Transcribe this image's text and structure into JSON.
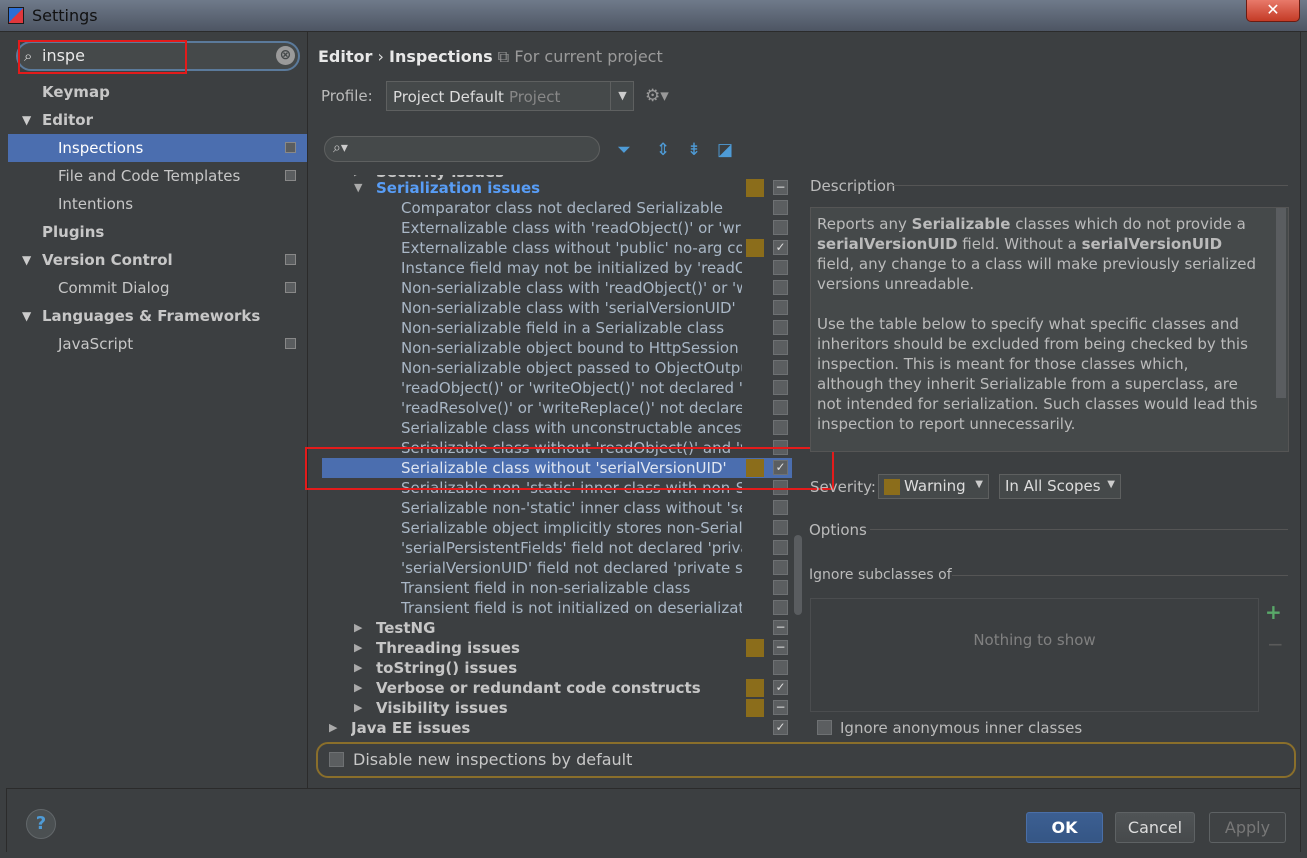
{
  "window": {
    "title": "Settings",
    "close_glyph": "✕"
  },
  "search": {
    "value": "inspe",
    "icon": "search-icon",
    "clear_glyph": "⊗"
  },
  "nav": {
    "items": [
      {
        "label": "Keymap",
        "level": 0,
        "bold": true
      },
      {
        "label": "Editor",
        "level": 0,
        "bold": true,
        "expanded": true
      },
      {
        "label": "Inspections",
        "level": 1,
        "selected": true
      },
      {
        "label": "File and Code Templates",
        "level": 1
      },
      {
        "label": "Intentions",
        "level": 1
      },
      {
        "label": "Plugins",
        "level": 0,
        "bold": true
      },
      {
        "label": "Version Control",
        "level": 0,
        "bold": true,
        "expanded": true
      },
      {
        "label": "Commit Dialog",
        "level": 1
      },
      {
        "label": "Languages & Frameworks",
        "level": 0,
        "bold": true,
        "expanded": true
      },
      {
        "label": "JavaScript",
        "level": 1
      }
    ]
  },
  "breadcrumb": {
    "part1": "Editor",
    "sep": "›",
    "part2": "Inspections",
    "scope": "For current project"
  },
  "profile": {
    "label": "Profile:",
    "value": "Project Default",
    "hint": "Project"
  },
  "tree": {
    "rows": [
      {
        "text": "Security issues",
        "type": "group-partial"
      },
      {
        "text": "Serialization issues",
        "type": "group-open",
        "sev": true,
        "cb": "−"
      },
      {
        "text": "Comparator class not declared Serializable",
        "type": "item",
        "cb": ""
      },
      {
        "text": "Externalizable class with 'readObject()' or 'writeObject()'",
        "type": "item",
        "cb": ""
      },
      {
        "text": "Externalizable class without 'public' no-arg constructor",
        "type": "item",
        "sev": true,
        "cb": "✓"
      },
      {
        "text": "Instance field may not be initialized by 'readObject()'",
        "type": "item",
        "cb": ""
      },
      {
        "text": "Non-serializable class with 'readObject()' or 'writeObject()'",
        "type": "item",
        "cb": ""
      },
      {
        "text": "Non-serializable class with 'serialVersionUID'",
        "type": "item",
        "cb": ""
      },
      {
        "text": "Non-serializable field in a Serializable class",
        "type": "item",
        "cb": ""
      },
      {
        "text": "Non-serializable object bound to HttpSession",
        "type": "item",
        "cb": ""
      },
      {
        "text": "Non-serializable object passed to ObjectOutputStream",
        "type": "item",
        "cb": ""
      },
      {
        "text": "'readObject()' or 'writeObject()' not declared 'private'",
        "type": "item",
        "cb": ""
      },
      {
        "text": "'readResolve()' or 'writeReplace()' not declared 'protected'",
        "type": "item",
        "cb": ""
      },
      {
        "text": "Serializable class with unconstructable ancestor",
        "type": "item",
        "cb": ""
      },
      {
        "text": "Serializable class without 'readObject()' and 'writeObject()'",
        "type": "item",
        "cb": ""
      },
      {
        "text": "Serializable class without 'serialVersionUID'",
        "type": "item",
        "sev": true,
        "cb": "✓",
        "selected": true
      },
      {
        "text": "Serializable non-'static' inner class with non-Serializable outer class",
        "type": "item",
        "cb": ""
      },
      {
        "text": "Serializable non-'static' inner class without 'serialVersionUID'",
        "type": "item",
        "cb": ""
      },
      {
        "text": "Serializable object implicitly stores non-Serializable object",
        "type": "item",
        "cb": ""
      },
      {
        "text": "'serialPersistentFields' field not declared 'private static final'",
        "type": "item",
        "cb": ""
      },
      {
        "text": "'serialVersionUID' field not declared 'private static final long'",
        "type": "item",
        "cb": ""
      },
      {
        "text": "Transient field in non-serializable class",
        "type": "item",
        "cb": ""
      },
      {
        "text": "Transient field is not initialized on deserialization",
        "type": "item",
        "cb": ""
      },
      {
        "text": "TestNG",
        "type": "group",
        "cb": "−"
      },
      {
        "text": "Threading issues",
        "type": "group",
        "sev": true,
        "cb": "−"
      },
      {
        "text": "toString() issues",
        "type": "group",
        "cb": ""
      },
      {
        "text": "Verbose or redundant code constructs",
        "type": "group",
        "sev": true,
        "cb": "✓"
      },
      {
        "text": "Visibility issues",
        "type": "group",
        "sev": true,
        "cb": "−"
      },
      {
        "text": "Java EE issues",
        "type": "group-top",
        "cb": "✓"
      }
    ]
  },
  "description": {
    "label": "Description",
    "p1_a": "Reports any ",
    "p1_b": "Serializable",
    "p1_c": " classes which do not provide a ",
    "p1_d": "serialVersionUID",
    "p1_e": " field. Without a ",
    "p1_f": "serialVersionUID",
    "p1_g": " field, any change to a class will make previously serialized versions unreadable.",
    "p2": "Use the table below to specify what specific classes and inheritors should be excluded from being checked by this inspection. This is meant for those classes which, although they inherit Serializable from a superclass, are not intended for serialization. Such classes would lead this inspection to report unnecessarily."
  },
  "severity": {
    "label": "Severity:",
    "value": "Warning",
    "scope": "In All Scopes"
  },
  "options": {
    "label": "Options",
    "ignore_label": "Ignore subclasses of",
    "empty_text": "Nothing to show",
    "anon_label": "Ignore anonymous inner classes"
  },
  "disable_new": {
    "label": "Disable new inspections by default"
  },
  "buttons": {
    "ok": "OK",
    "cancel": "Cancel",
    "apply": "Apply",
    "help": "?"
  },
  "colors": {
    "selection": "#4b6eaf",
    "warning": "#8b6d1b",
    "highlight_box": "#e31b1b"
  }
}
